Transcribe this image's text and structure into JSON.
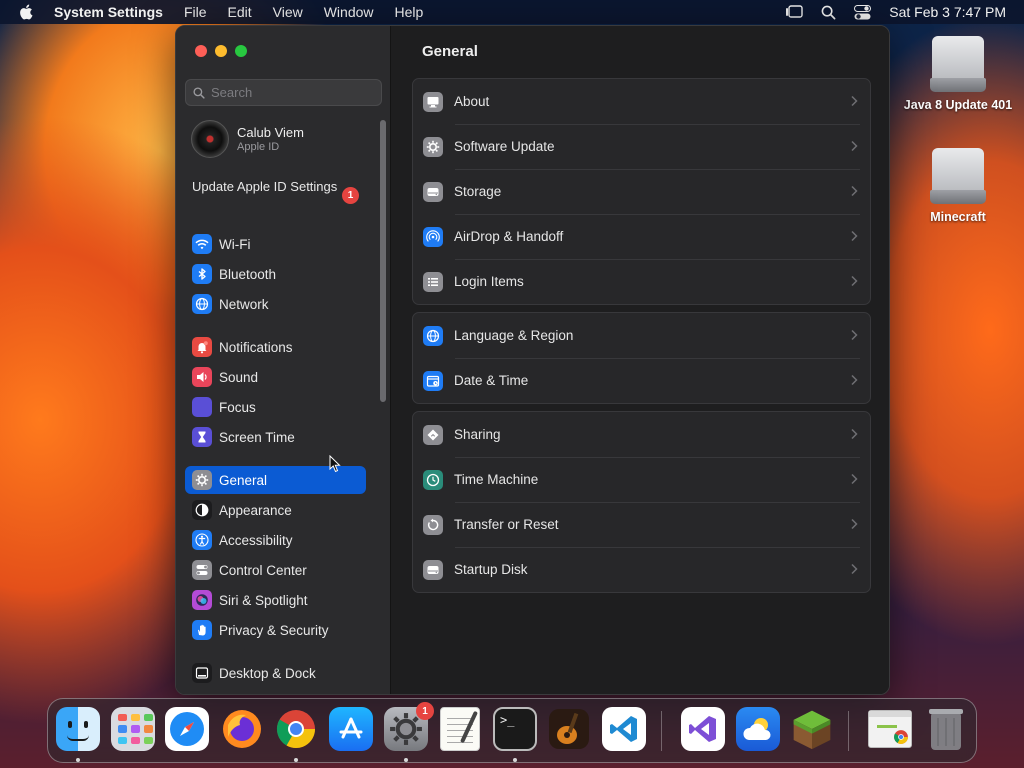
{
  "menubar": {
    "app_name": "System Settings",
    "menus": [
      "File",
      "Edit",
      "View",
      "Window",
      "Help"
    ],
    "clock": "Sat Feb 3  7:47 PM"
  },
  "desktop": {
    "icons": [
      {
        "label": "Java 8 Update 401"
      },
      {
        "label": "Minecraft"
      }
    ]
  },
  "window": {
    "search": {
      "placeholder": "Search",
      "value": ""
    },
    "account": {
      "name": "Calub Viem",
      "subtitle": "Apple ID"
    },
    "update_notice": {
      "label": "Update Apple ID Settings",
      "badge": "1"
    },
    "sidebar": {
      "groups": [
        [
          {
            "label": "Wi-Fi",
            "icon": "wifi-icon",
            "color": "#1f7cf5"
          },
          {
            "label": "Bluetooth",
            "icon": "bluetooth-icon",
            "color": "#1f7cf5"
          },
          {
            "label": "Network",
            "icon": "globe-icon",
            "color": "#1f7cf5"
          }
        ],
        [
          {
            "label": "Notifications",
            "icon": "bell-icon",
            "color": "#e94a42"
          },
          {
            "label": "Sound",
            "icon": "speaker-icon",
            "color": "#e9455a"
          },
          {
            "label": "Focus",
            "icon": "moon-icon",
            "color": "#5a4fd6"
          },
          {
            "label": "Screen Time",
            "icon": "hourglass-icon",
            "color": "#5a4fd6"
          }
        ],
        [
          {
            "label": "General",
            "icon": "gear-icon",
            "color": "#8e8e93",
            "active": true
          },
          {
            "label": "Appearance",
            "icon": "appearance-icon",
            "color": "#1c1c1e"
          },
          {
            "label": "Accessibility",
            "icon": "accessibility-icon",
            "color": "#1f7cf5"
          },
          {
            "label": "Control Center",
            "icon": "control-center-icon",
            "color": "#8e8e93"
          },
          {
            "label": "Siri & Spotlight",
            "icon": "siri-icon",
            "color": "#b44bd6"
          },
          {
            "label": "Privacy & Security",
            "icon": "hand-icon",
            "color": "#1f7cf5"
          }
        ],
        [
          {
            "label": "Desktop & Dock",
            "icon": "dock-icon",
            "color": "#1c1c1e"
          }
        ]
      ]
    },
    "content": {
      "title": "General",
      "groups": [
        [
          {
            "label": "About",
            "icon": "display-icon",
            "color": "#8e8e93"
          },
          {
            "label": "Software Update",
            "icon": "gear-icon",
            "color": "#8e8e93"
          },
          {
            "label": "Storage",
            "icon": "drive-icon",
            "color": "#8e8e93"
          },
          {
            "label": "AirDrop & Handoff",
            "icon": "airdrop-icon",
            "color": "#1f7cf5"
          },
          {
            "label": "Login Items",
            "icon": "list-icon",
            "color": "#8e8e93"
          }
        ],
        [
          {
            "label": "Language & Region",
            "icon": "globe-icon",
            "color": "#1f7cf5"
          },
          {
            "label": "Date & Time",
            "icon": "calendar-icon",
            "color": "#1f7cf5"
          }
        ],
        [
          {
            "label": "Sharing",
            "icon": "sharing-icon",
            "color": "#8e8e93"
          },
          {
            "label": "Time Machine",
            "icon": "time-machine-icon",
            "color": "#2a8c7a"
          },
          {
            "label": "Transfer or Reset",
            "icon": "reset-icon",
            "color": "#8e8e93"
          },
          {
            "label": "Startup Disk",
            "icon": "drive-icon",
            "color": "#8e8e93"
          }
        ]
      ]
    }
  },
  "dock": {
    "apps": [
      {
        "name": "finder-icon",
        "running": true
      },
      {
        "name": "launchpad-icon",
        "running": false
      },
      {
        "name": "safari-icon",
        "running": false
      },
      {
        "name": "firefox-icon",
        "running": false
      },
      {
        "name": "chrome-icon",
        "running": true
      },
      {
        "name": "app-store-icon",
        "running": false
      },
      {
        "name": "system-settings-icon",
        "running": true,
        "badge": "1"
      },
      {
        "name": "textedit-icon",
        "running": false
      },
      {
        "name": "terminal-icon",
        "running": true
      },
      {
        "name": "garageband-icon",
        "running": false
      },
      {
        "name": "vscode-icon",
        "running": false
      },
      {
        "name": "visual-studio-icon",
        "running": false
      },
      {
        "name": "weather-icon",
        "running": false
      },
      {
        "name": "minecraft-icon",
        "running": false
      },
      {
        "name": "chrome-window-icon",
        "running": false
      },
      {
        "name": "trash-icon",
        "running": false
      }
    ]
  }
}
